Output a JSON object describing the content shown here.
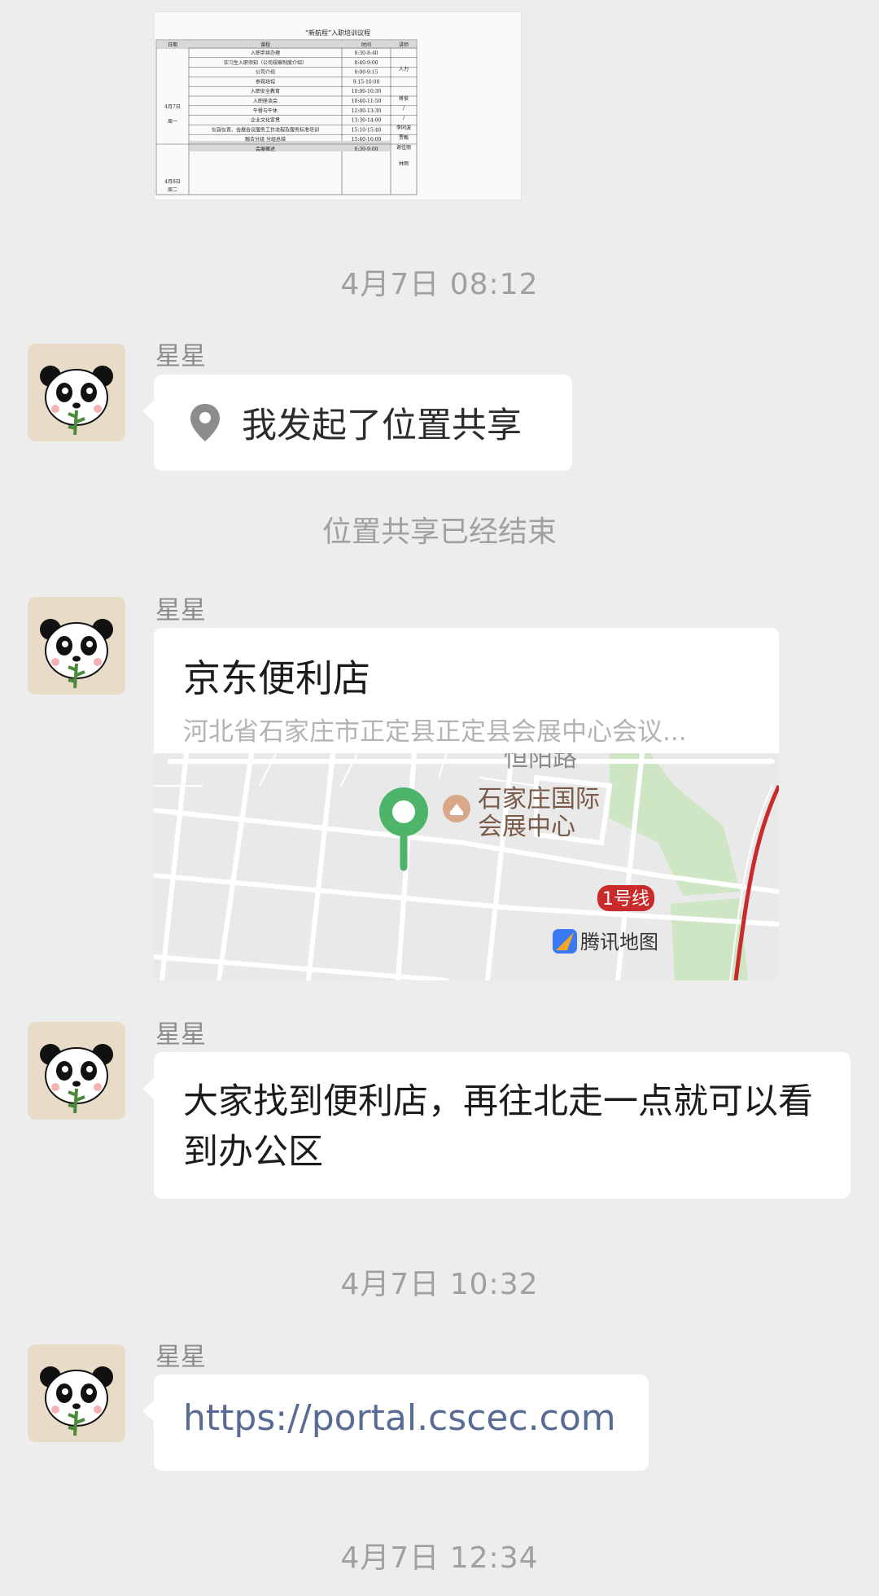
{
  "schedule_image": {
    "title": "“新航程”入职培训议程",
    "headers": [
      "日期",
      "课程",
      "时间",
      "讲师"
    ],
    "day1_label": "4月7日",
    "day1_weekday": "周一",
    "rows": [
      {
        "course": "入职手续办理",
        "time": "8:30-8:40"
      },
      {
        "course": "实习生入职须知（公司规章制度介绍）",
        "time": "8:40-9:00"
      },
      {
        "course": "公司介绍",
        "time": "9:00-9:15"
      },
      {
        "course": "参观场馆",
        "time": "9:15-10:00"
      },
      {
        "course": "入职安全教育",
        "time": "10:00-10:30"
      },
      {
        "course": "入职座谈会",
        "time": "10:40-11:50"
      },
      {
        "course": "午餐与午休",
        "time": "12:00-13:30"
      },
      {
        "course": "企业文化宣贯",
        "time": "13:30-14:00"
      },
      {
        "course": "仪容仪表、会展会议服务工作流程及服务标准培训",
        "time": "15:10-15:40"
      },
      {
        "course": "融合分组 分组总结",
        "time": "15:40-16:00"
      },
      {
        "course": "会展概述",
        "time": "8:30-9:00"
      }
    ],
    "lecturers": [
      "人力",
      "蒋俊",
      "/",
      "/",
      "李同波",
      "贾甄",
      "谢佳丽",
      "林雨"
    ],
    "day2_label": "4月8日",
    "day2_weekday": "周二"
  },
  "messages": {
    "time1": "4月7日 08:12",
    "sender": "星星",
    "location_share_text": "我发起了位置共享",
    "system_notice": "位置共享已经结束",
    "location_card": {
      "title": "京东便利店",
      "address": "河北省石家庄市正定县正定县会展中心会议...",
      "map": {
        "poi_name_line1": "石家庄国际",
        "poi_name_line2": "会展中心",
        "road_label": "恒阳路",
        "metro_badge": "1号线",
        "map_provider": "腾讯地图",
        "pin_color": "#4cb56a",
        "metro_color": "#c92a2a"
      }
    },
    "text_message": "大家找到便利店，再往北走一点就可以看到办公区",
    "time2": "4月7日 10:32",
    "link_text": "https://portal.cscec.com",
    "time3": "4月7日 12:34"
  },
  "colors": {
    "background": "#ededed",
    "bubble": "#ffffff",
    "link": "#576b95",
    "timestamp": "#a0a0a0"
  }
}
